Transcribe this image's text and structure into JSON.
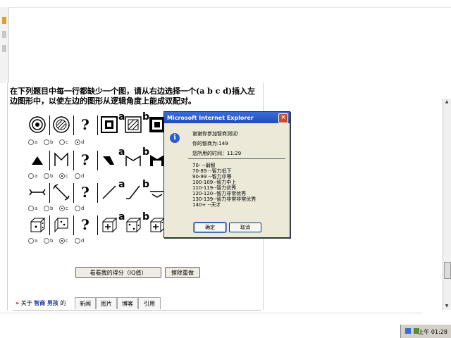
{
  "page": {
    "instruction": "在下列题目中每一行都缺少一个图，请从右边选择一个(a b c d)插入左边图形中，以使左边的图形从逻辑角度上能成双配对。",
    "question_mark": "?",
    "option_letters": [
      "a",
      "b"
    ],
    "radio_labels": [
      "a",
      "b",
      "c",
      "d"
    ],
    "buttons": {
      "score": "看看我的得分（IQ值）",
      "reset": "擦除重做"
    },
    "about": {
      "arrows": "»",
      "prefix": "关于",
      "kw1": "智商",
      "kw2": "男孩",
      "suffix": "的"
    },
    "tabs": [
      "新闻",
      "图片",
      "博客",
      "引用"
    ]
  },
  "rows": [
    {
      "checked": 3
    },
    {
      "checked": 2
    },
    {
      "checked": 2
    },
    {
      "checked": 2
    }
  ],
  "dialog": {
    "title": "Microsoft Internet Explorer",
    "close": "×",
    "icon": "i",
    "thanks": "谢谢你参加智商测试!",
    "score_line": "你的智商为:149",
    "time_line": "您所用的时间：11:29",
    "scale": [
      "70-  --弱智",
      "70-89 --智力低下",
      "90-99 --智力中等",
      "100-109--智力中上",
      "110-119--智力优秀",
      "120-120--智力非常优秀",
      "130-139--智力非常非常优秀",
      "140+  --天才"
    ],
    "ok": "确定",
    "cancel": "取消"
  },
  "taskbar": {
    "time": "上午 01:28"
  },
  "colors": {
    "titlebar": "#1f4fb8",
    "dialog_bg": "#ece9d8",
    "link": "#1a3aa0"
  }
}
